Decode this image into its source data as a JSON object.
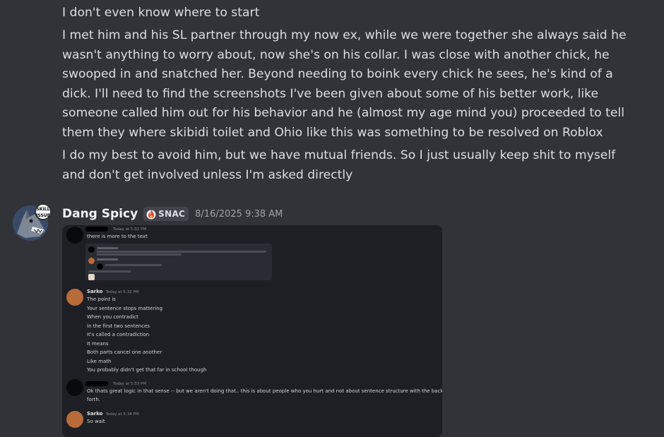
{
  "messages": [
    {
      "text": "I don't even know where to start"
    },
    {
      "text": "I met him and his SL partner through my now ex, while we were together she always said he wasn't anything to worry about, now she's on his collar. I was close with another chick, he swooped in and snatched her. Beyond needing to boink every chick he sees, he's kind of a dick. I'll need to find the screenshots I've been given about some of his better work, like someone called him out for his behavior and he (almost my age mind you) proceeded to tell them they where skibidi toilet and Ohio like this was something to be resolved on Roblox"
    },
    {
      "text": "I do my best to avoid him, but we have mutual friends. So I just usually keep shit to myself and don't get involved unless I'm asked directly"
    }
  ],
  "post": {
    "username": "Dang Spicy",
    "badge_avatar": "SKILL ISSUE",
    "tag": "SNAC",
    "tag_icon": "fire-icon",
    "timestamp": "8/16/2025 9:38 AM"
  },
  "screenshot": {
    "msg1": {
      "time": "Today at 5:32 PM",
      "text": "there is more to the text"
    },
    "sarko1": {
      "name": "Sarko",
      "time": "Today at 5:32 PM",
      "lines": [
        "The point is",
        "Your sentence stops mattering",
        "When you contradict",
        "In the first two sentences",
        "It's called a contradiction",
        "It means",
        "Both parts cancel one another",
        "Like math",
        "You probably didn't get that far in school though"
      ]
    },
    "msg2": {
      "time": "Today at 5:33 PM",
      "lines": [
        "Ok thats great logic in that sense -- but we aren't doing that.. this is about people who you hurt and not about sentence structure with the back and",
        "forth."
      ]
    },
    "sarko2": {
      "name": "Sarko",
      "time": "Today at 5:34 PM",
      "lines": [
        "So wait"
      ]
    }
  },
  "colors": {
    "background": "#323339",
    "attachment_bg": "#1d1f24",
    "tag_bg": "#43444c"
  }
}
